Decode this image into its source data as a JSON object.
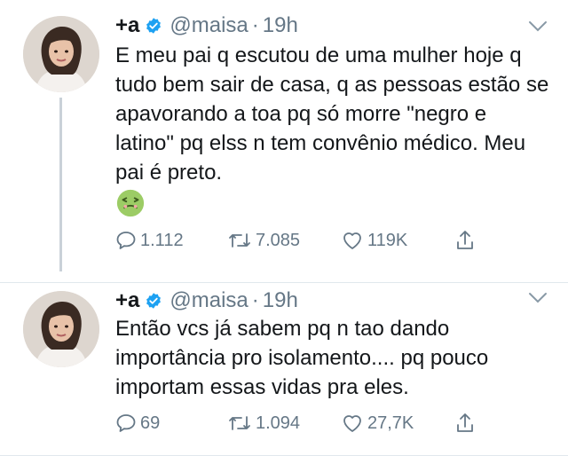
{
  "tweets": [
    {
      "display_name": "+a",
      "handle": "@maisa",
      "separator": "·",
      "time": "19h",
      "text": "E meu pai q escutou de uma mulher hoje q tudo bem sair de casa, q as pessoas estão se apavorando a toa pq só morre \"negro e latino\" pq elss n tem convênio médico. Meu pai é preto.",
      "emoji": "nauseated-face",
      "replies": "1.112",
      "retweets": "7.085",
      "likes": "119K"
    },
    {
      "display_name": "+a",
      "handle": "@maisa",
      "separator": "·",
      "time": "19h",
      "text": "Então vcs já sabem pq n tao dando importância pro isolamento.... pq pouco importam essas vidas pra eles.",
      "replies": "69",
      "retweets": "1.094",
      "likes": "27,7K"
    }
  ],
  "colors": {
    "text": "#14171a",
    "secondary": "#657786",
    "verified": "#1da1f2",
    "thread_line": "#c9d1d8"
  }
}
